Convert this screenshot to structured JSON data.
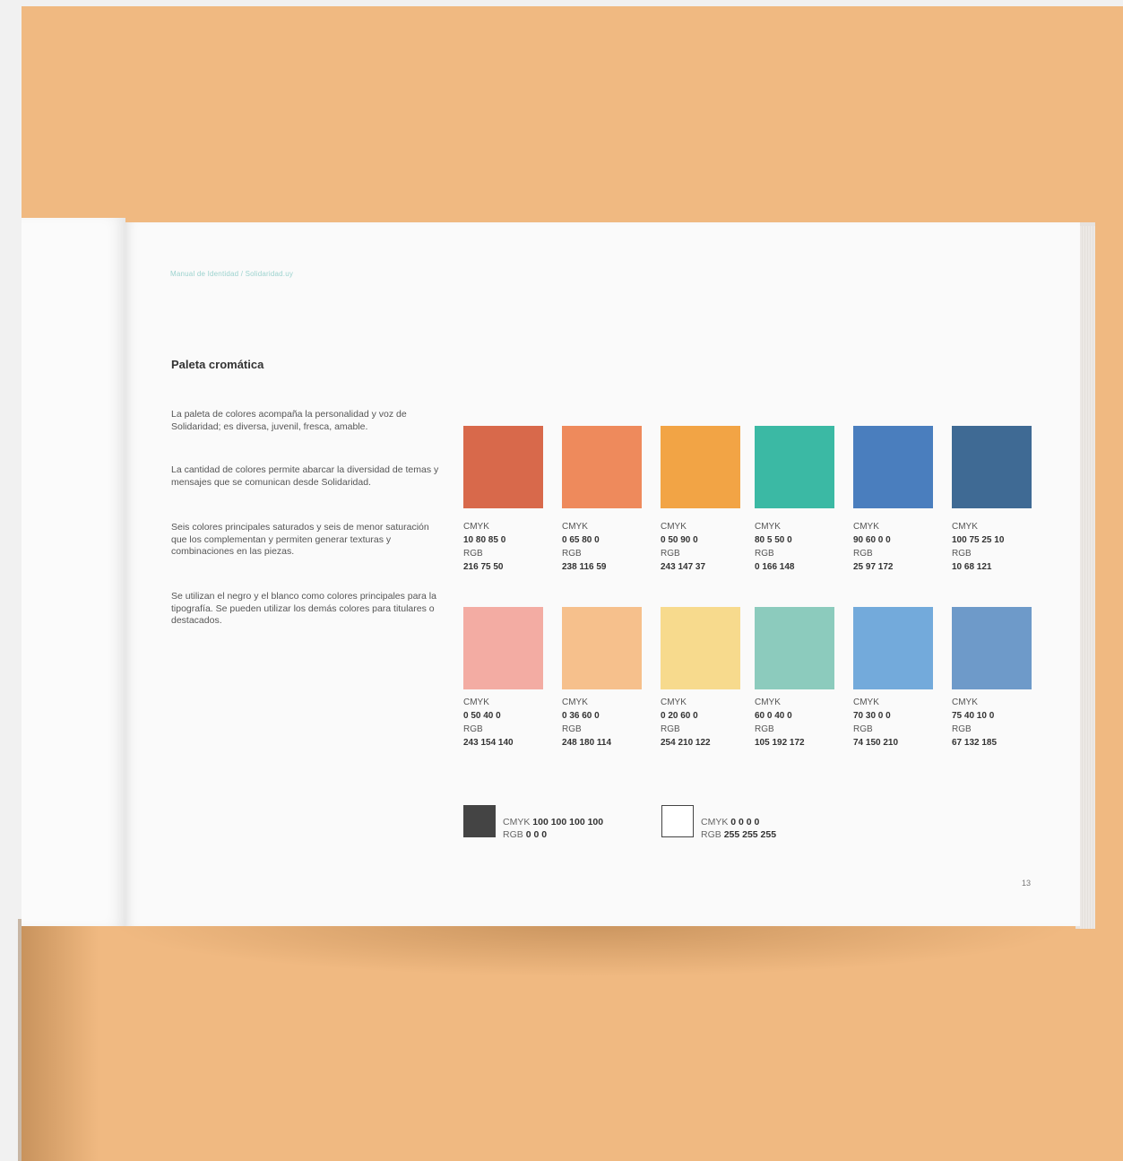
{
  "page": {
    "header": "Manual de Identidad / Solidaridad.uy",
    "title": "Paleta cromática",
    "paragraphs": [
      "La paleta de colores acompaña la personalidad y voz de Solidaridad; es diversa, juvenil, fresca, amable.",
      "La cantidad de colores permite abarcar la diversidad de temas y mensajes que se comunican desde Solidaridad.",
      "Seis colores principales saturados y seis de menor saturación que los complementan y permiten generar texturas y combinaciones en las piezas.",
      "Se utilizan el negro y el blanco como colores principales para la tipografía. Se pueden utilizar los demás colores para titulares o destacados."
    ],
    "page_number": "13"
  },
  "palette": {
    "cmyk_label": "CMYK",
    "rgb_label": "RGB",
    "row1": [
      {
        "color": "#d8694b",
        "cmyk": "10 80 85 0",
        "rgb": "216 75 50"
      },
      {
        "color": "#ee8a5c",
        "cmyk": "0 65 80 0",
        "rgb": "238 116 59"
      },
      {
        "color": "#f2a445",
        "cmyk": "0 50 90 0",
        "rgb": "243 147 37"
      },
      {
        "color": "#3bb9a4",
        "cmyk": "80 5 50 0",
        "rgb": "0 166 148"
      },
      {
        "color": "#4a7ebe",
        "cmyk": "90 60 0 0",
        "rgb": "25 97 172"
      },
      {
        "color": "#3f6a94",
        "cmyk": "100 75 25 10",
        "rgb": "10 68 121"
      }
    ],
    "row2": [
      {
        "color": "#f3aca3",
        "cmyk": "0 50 40 0",
        "rgb": "243 154 140"
      },
      {
        "color": "#f6c08c",
        "cmyk": "0 36 60 0",
        "rgb": "248 180 114"
      },
      {
        "color": "#f7da8d",
        "cmyk": "0 20 60 0",
        "rgb": "254 210 122"
      },
      {
        "color": "#8ccbbd",
        "cmyk": "60 0 40 0",
        "rgb": "105 192 172"
      },
      {
        "color": "#73aadb",
        "cmyk": "70 30 0 0",
        "rgb": "74 150 210"
      },
      {
        "color": "#6e9ac9",
        "cmyk": "75 40 10 0",
        "rgb": "67 132 185"
      }
    ],
    "black": {
      "color": "#444444",
      "cmyk_prefix": "CMYK",
      "cmyk": "100 100 100 100",
      "rgb_prefix": "RGB",
      "rgb": "0 0 0"
    },
    "white": {
      "color": "#ffffff",
      "cmyk_prefix": "CMYK",
      "cmyk": "0 0 0 0",
      "rgb_prefix": "RGB",
      "rgb": "255 255 255"
    }
  }
}
